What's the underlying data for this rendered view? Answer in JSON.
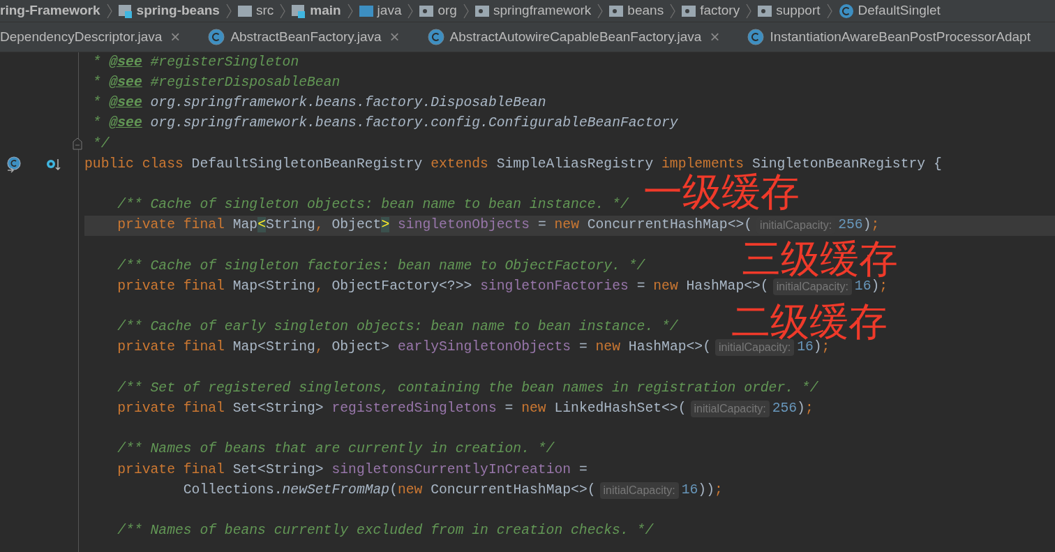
{
  "breadcrumbs": [
    {
      "label": "ring-Framework",
      "kind": "module"
    },
    {
      "label": "spring-beans",
      "kind": "module"
    },
    {
      "label": "src",
      "kind": "folder"
    },
    {
      "label": "main",
      "kind": "module"
    },
    {
      "label": "java",
      "kind": "source"
    },
    {
      "label": "org",
      "kind": "package"
    },
    {
      "label": "springframework",
      "kind": "package"
    },
    {
      "label": "beans",
      "kind": "package"
    },
    {
      "label": "factory",
      "kind": "package"
    },
    {
      "label": "support",
      "kind": "package"
    },
    {
      "label": "DefaultSinglet",
      "kind": "class"
    }
  ],
  "tabs": [
    {
      "label": "DependencyDescriptor.java",
      "kind": "plain",
      "close": "×"
    },
    {
      "label": "AbstractBeanFactory.java",
      "kind": "class",
      "close": "×"
    },
    {
      "label": "AbstractAutowireCapableBeanFactory.java",
      "kind": "class",
      "close": "×"
    },
    {
      "label": "InstantiationAwareBeanPostProcessorAdapt",
      "kind": "class"
    }
  ],
  "lines": [
    {
      "kind": "doc",
      "current": false,
      "tokens": [
        {
          "kind": "comment",
          "text": " * "
        },
        {
          "kind": "tag",
          "text": "@see"
        },
        {
          "kind": "comment",
          "text": " #registerSingleton"
        }
      ]
    },
    {
      "kind": "doc",
      "current": false,
      "tokens": [
        {
          "kind": "comment",
          "text": " * "
        },
        {
          "kind": "tag",
          "text": "@see"
        },
        {
          "kind": "comment",
          "text": " #registerDisposableBean"
        }
      ]
    },
    {
      "kind": "doc",
      "current": false,
      "tokens": [
        {
          "kind": "comment",
          "text": " * "
        },
        {
          "kind": "tag",
          "text": "@see"
        },
        {
          "kind": "ref",
          "text": " org.springframework.beans.factory.DisposableBean"
        }
      ]
    },
    {
      "kind": "doc",
      "current": false,
      "tokens": [
        {
          "kind": "comment",
          "text": " * "
        },
        {
          "kind": "tag",
          "text": "@see"
        },
        {
          "kind": "ref",
          "text": " org.springframework.beans.factory.config.ConfigurableBeanFactory"
        }
      ]
    },
    {
      "kind": "doc-end",
      "current": false,
      "tokens": [
        {
          "kind": "comment",
          "text": " */"
        }
      ]
    },
    {
      "kind": "declaration",
      "current": false,
      "tokens": [
        {
          "kind": "keyword",
          "text": "public class "
        },
        {
          "kind": "plain",
          "text": "DefaultSingletonBeanRegistry "
        },
        {
          "kind": "keyword",
          "text": "extends "
        },
        {
          "kind": "plain",
          "text": "SimpleAliasRegistry "
        },
        {
          "kind": "keyword",
          "text": "implements "
        },
        {
          "kind": "plain",
          "text": "SingletonBeanRegistry {"
        }
      ]
    },
    {
      "kind": "blank",
      "current": false
    },
    {
      "kind": "code",
      "current": false,
      "tokens": [
        {
          "kind": "comment",
          "text": "    /** Cache of singleton objects: bean name to bean instance. */"
        }
      ]
    },
    {
      "kind": "code",
      "current": true,
      "tokens": [
        {
          "kind": "keyword",
          "text": "    private final "
        },
        {
          "kind": "plain",
          "text": "Map"
        },
        {
          "kind": "bracket",
          "text": "<"
        },
        {
          "kind": "plain",
          "text": "String"
        },
        {
          "kind": "keyword",
          "text": ", "
        },
        {
          "kind": "plain",
          "text": "Object"
        },
        {
          "kind": "bracket",
          "text": ">"
        },
        {
          "kind": "field",
          "text": " singletonObjects"
        },
        {
          "kind": "plain",
          "text": " = "
        },
        {
          "kind": "keyword",
          "text": "new "
        },
        {
          "kind": "plain",
          "text": "ConcurrentHashMap<>("
        },
        {
          "kind": "hint",
          "text": "initialCapacity:"
        },
        {
          "kind": "number",
          "text": "256"
        },
        {
          "kind": "plain",
          "text": ")"
        },
        {
          "kind": "keyword",
          "text": ";"
        }
      ]
    },
    {
      "kind": "blank",
      "current": false
    },
    {
      "kind": "code",
      "current": false,
      "tokens": [
        {
          "kind": "comment",
          "text": "    /** Cache of singleton factories: bean name to ObjectFactory. */"
        }
      ]
    },
    {
      "kind": "code",
      "current": false,
      "tokens": [
        {
          "kind": "keyword",
          "text": "    private final "
        },
        {
          "kind": "plain",
          "text": "Map<String"
        },
        {
          "kind": "keyword",
          "text": ", "
        },
        {
          "kind": "plain",
          "text": "ObjectFactory<?>> "
        },
        {
          "kind": "field",
          "text": "singletonFactories"
        },
        {
          "kind": "plain",
          "text": " = "
        },
        {
          "kind": "keyword",
          "text": "new "
        },
        {
          "kind": "plain",
          "text": "HashMap<>("
        },
        {
          "kind": "hint",
          "text": "initialCapacity:"
        },
        {
          "kind": "number",
          "text": "16"
        },
        {
          "kind": "plain",
          "text": ")"
        },
        {
          "kind": "keyword",
          "text": ";"
        }
      ]
    },
    {
      "kind": "blank",
      "current": false
    },
    {
      "kind": "code",
      "current": false,
      "tokens": [
        {
          "kind": "comment",
          "text": "    /** Cache of early singleton objects: bean name to bean instance. */"
        }
      ]
    },
    {
      "kind": "code",
      "current": false,
      "tokens": [
        {
          "kind": "keyword",
          "text": "    private final "
        },
        {
          "kind": "plain",
          "text": "Map<String"
        },
        {
          "kind": "keyword",
          "text": ", "
        },
        {
          "kind": "plain",
          "text": "Object> "
        },
        {
          "kind": "field",
          "text": "earlySingletonObjects"
        },
        {
          "kind": "plain",
          "text": " = "
        },
        {
          "kind": "keyword",
          "text": "new "
        },
        {
          "kind": "plain",
          "text": "HashMap<>("
        },
        {
          "kind": "hint",
          "text": "initialCapacity:"
        },
        {
          "kind": "number",
          "text": "16"
        },
        {
          "kind": "plain",
          "text": ")"
        },
        {
          "kind": "keyword",
          "text": ";"
        }
      ]
    },
    {
      "kind": "blank",
      "current": false
    },
    {
      "kind": "code",
      "current": false,
      "tokens": [
        {
          "kind": "comment",
          "text": "    /** Set of registered singletons, containing the bean names in registration order. */"
        }
      ]
    },
    {
      "kind": "code",
      "current": false,
      "tokens": [
        {
          "kind": "keyword",
          "text": "    private final "
        },
        {
          "kind": "plain",
          "text": "Set<String> "
        },
        {
          "kind": "field",
          "text": "registeredSingletons"
        },
        {
          "kind": "plain",
          "text": " = "
        },
        {
          "kind": "keyword",
          "text": "new "
        },
        {
          "kind": "plain",
          "text": "LinkedHashSet<>("
        },
        {
          "kind": "hint",
          "text": "initialCapacity:"
        },
        {
          "kind": "number",
          "text": "256"
        },
        {
          "kind": "plain",
          "text": ")"
        },
        {
          "kind": "keyword",
          "text": ";"
        }
      ]
    },
    {
      "kind": "blank",
      "current": false
    },
    {
      "kind": "code",
      "current": false,
      "tokens": [
        {
          "kind": "comment",
          "text": "    /** Names of beans that are currently in creation. */"
        }
      ]
    },
    {
      "kind": "code",
      "current": false,
      "tokens": [
        {
          "kind": "keyword",
          "text": "    private final "
        },
        {
          "kind": "plain",
          "text": "Set<String> "
        },
        {
          "kind": "field",
          "text": "singletonsCurrentlyInCreation"
        },
        {
          "kind": "plain",
          "text": " ="
        }
      ]
    },
    {
      "kind": "code",
      "current": false,
      "tokens": [
        {
          "kind": "plain",
          "text": "            Collections."
        },
        {
          "kind": "method",
          "text": "newSetFromMap"
        },
        {
          "kind": "plain",
          "text": "("
        },
        {
          "kind": "keyword",
          "text": "new "
        },
        {
          "kind": "plain",
          "text": "ConcurrentHashMap<>("
        },
        {
          "kind": "hint",
          "text": "initialCapacity:"
        },
        {
          "kind": "number",
          "text": "16"
        },
        {
          "kind": "plain",
          "text": "))"
        },
        {
          "kind": "keyword",
          "text": ";"
        }
      ]
    },
    {
      "kind": "blank",
      "current": false
    },
    {
      "kind": "code",
      "current": false,
      "tokens": [
        {
          "kind": "comment",
          "text": "    /** Names of beans currently excluded from in creation checks. */"
        }
      ]
    }
  ],
  "annotations": [
    {
      "text": "一级缓存"
    },
    {
      "text": "三级缓存"
    },
    {
      "text": "二级缓存"
    }
  ]
}
